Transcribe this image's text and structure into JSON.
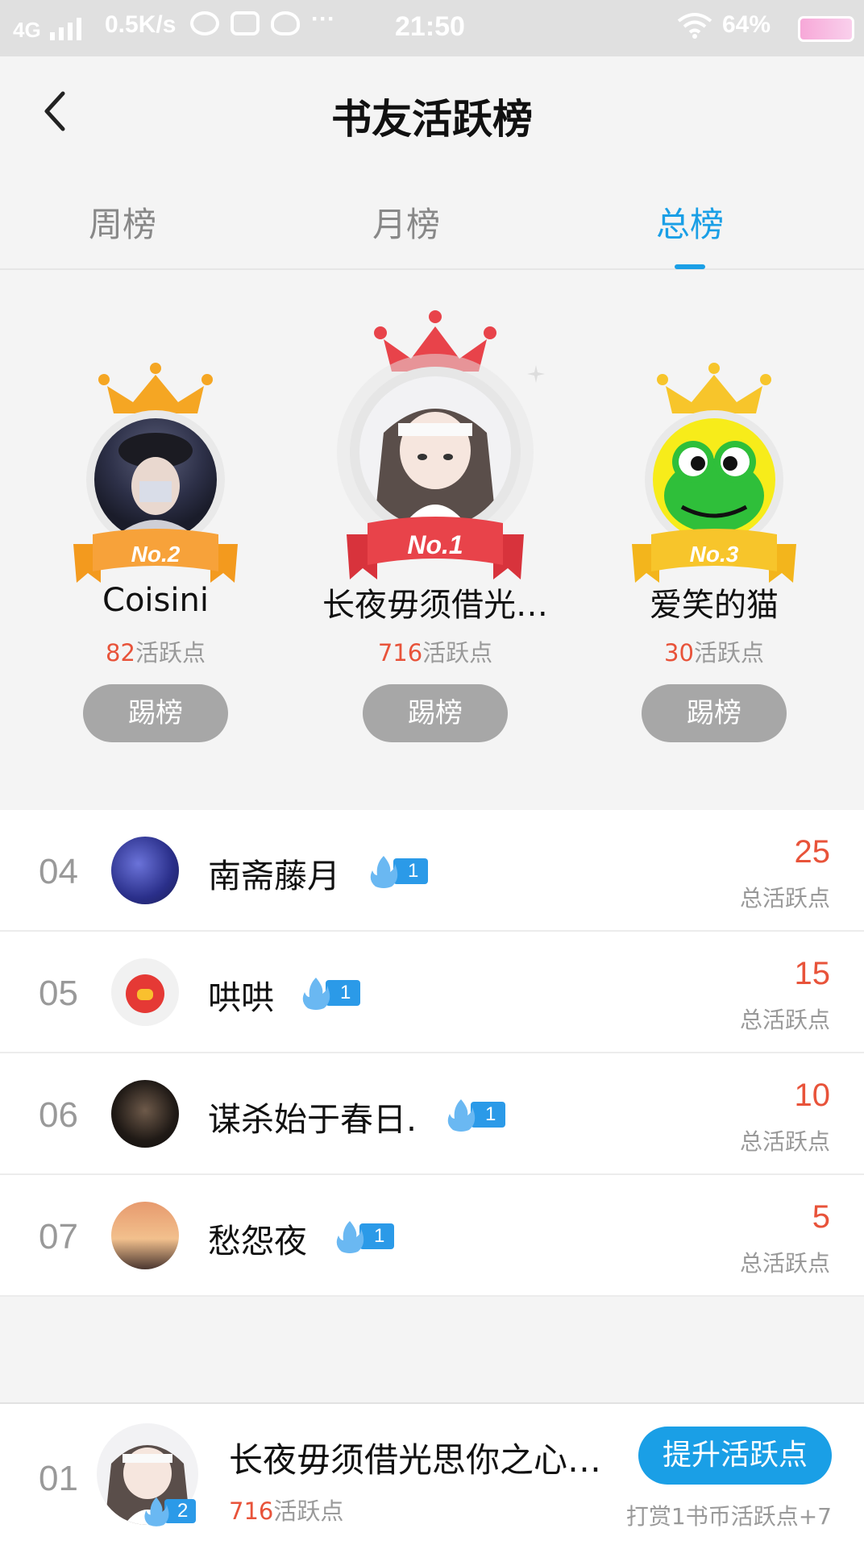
{
  "status_bar": {
    "network": "4G",
    "speed": "0.5K/s",
    "time": "21:50",
    "battery": "64%"
  },
  "header": {
    "title": "书友活跃榜"
  },
  "tabs": [
    {
      "label": "周榜",
      "active": false
    },
    {
      "label": "月榜",
      "active": false
    },
    {
      "label": "总榜",
      "active": true
    }
  ],
  "podium": {
    "first": {
      "badge": "No.1",
      "name": "长夜毋须借光…",
      "points": "716",
      "points_suffix": "活跃点",
      "button": "踢榜"
    },
    "second": {
      "badge": "No.2",
      "name": "Coisini",
      "points": "82",
      "points_suffix": "活跃点",
      "button": "踢榜"
    },
    "third": {
      "badge": "No.3",
      "name": "爱笑的猫",
      "points": "30",
      "points_suffix": "活跃点",
      "button": "踢榜"
    }
  },
  "list": [
    {
      "rank": "04",
      "name": "南斋藤月",
      "level": "1",
      "score": "25",
      "score_label": "总活跃点"
    },
    {
      "rank": "05",
      "name": "哄哄",
      "level": "1",
      "score": "15",
      "score_label": "总活跃点"
    },
    {
      "rank": "06",
      "name": "谋杀始于春日.",
      "level": "1",
      "score": "10",
      "score_label": "总活跃点"
    },
    {
      "rank": "07",
      "name": "愁怨夜",
      "level": "1",
      "score": "5",
      "score_label": "总活跃点"
    }
  ],
  "footer": {
    "rank": "01",
    "name": "长夜毋须借光思你之心…",
    "level": "2",
    "points": "716",
    "points_suffix": "活跃点",
    "button": "提升活跃点",
    "hint": "打赏1书币活跃点+7"
  },
  "colors": {
    "accent": "#1a9fe6",
    "score": "#e8533a",
    "first_crown": "#e8434a",
    "second_crown": "#f5a623",
    "third_crown": "#f7c52b"
  }
}
